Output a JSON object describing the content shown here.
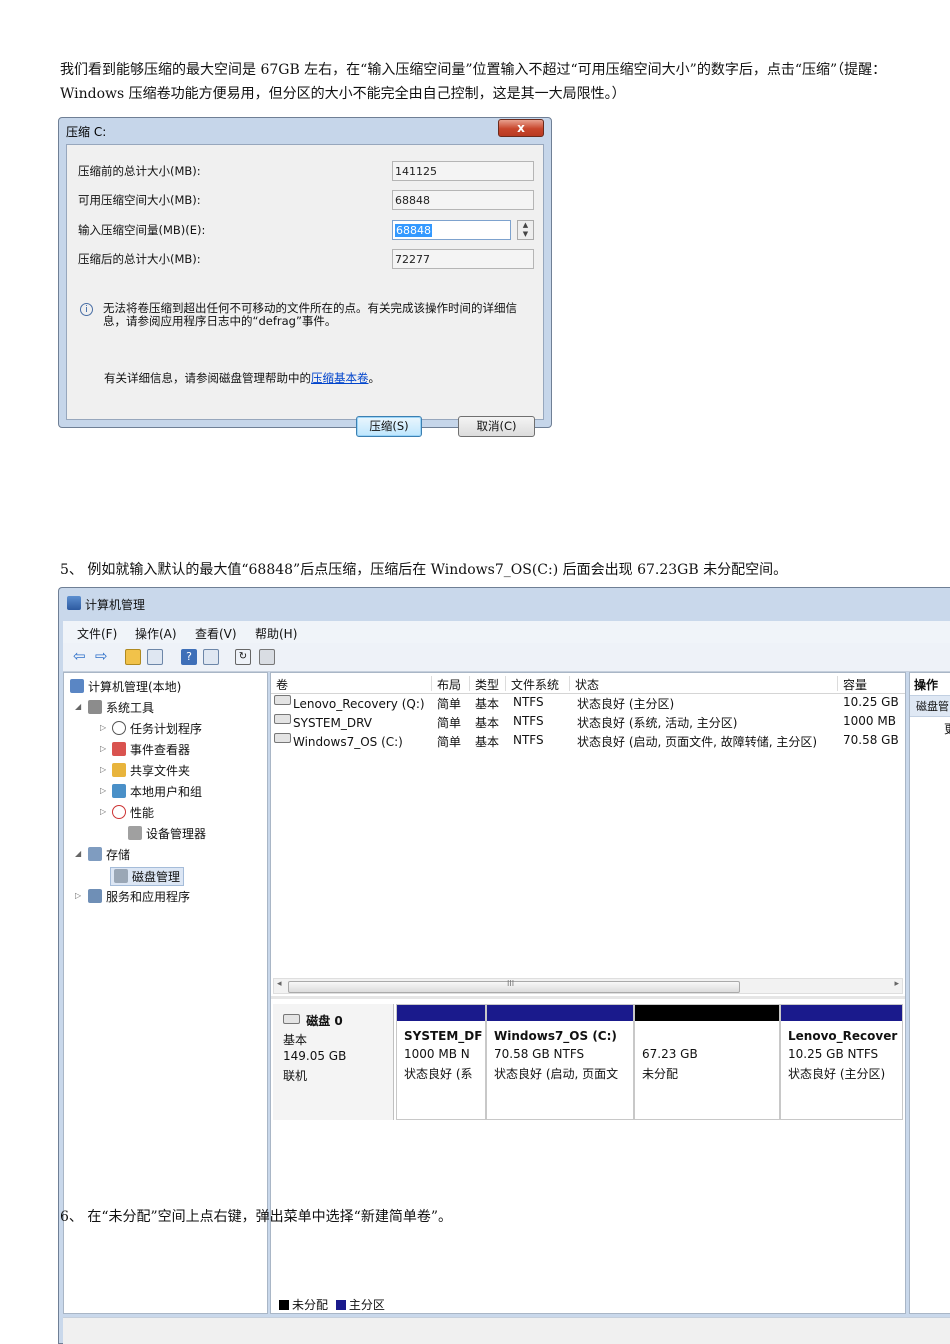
{
  "para1": "我们看到能够压缩的最大空间是 67GB 左右，在“输入压缩空间量”位置输入不超过“可用压缩空间大小”的数字后，点击“压缩”（提醒：Windows 压缩卷功能方便易用，但分区的大小不能完全由自己控制，这是其一大局限性。）",
  "dialog": {
    "title": "压缩 C:",
    "close_label": "x",
    "fields": [
      {
        "label": "压缩前的总计大小(MB):",
        "value": "141125"
      },
      {
        "label": "可用压缩空间大小(MB):",
        "value": "68848"
      },
      {
        "label": "输入压缩空间量(MB)(E):",
        "value": "68848"
      },
      {
        "label": "压缩后的总计大小(MB):",
        "value": "72277"
      }
    ],
    "note": "无法将卷压缩到超出任何不可移动的文件所在的点。有关完成该操作时间的详细信息，请参阅应用程序日志中的“defrag”事件。",
    "more_prefix": "有关详细信息，请参阅磁盘管理帮助中的",
    "more_link": "压缩基本卷",
    "more_suffix": "。",
    "shrink_button": "压缩(S)",
    "cancel_button": "取消(C)"
  },
  "para2": "5、 例如就输入默认的最大值“68848”后点压缩，压缩后在 Windows7_OS(C:) 后面会出现 67.23GB 未分配空间。",
  "para3": "6、 在“未分配”空间上点右键，弹出菜单中选择“新建简单卷”。",
  "cm": {
    "title": "计算机管理",
    "menu": [
      "文件(F)",
      "操作(A)",
      "查看(V)",
      "帮助(H)"
    ],
    "tree": {
      "root": "计算机管理(本地)",
      "system_tools": "系统工具",
      "task_scheduler": "任务计划程序",
      "event_viewer": "事件查看器",
      "shared_folders": "共享文件夹",
      "local_users": "本地用户和组",
      "performance": "性能",
      "device_manager": "设备管理器",
      "storage": "存储",
      "disk_management": "磁盘管理",
      "services": "服务和应用程序"
    },
    "columns": [
      "卷",
      "布局",
      "类型",
      "文件系统",
      "状态",
      "容量"
    ],
    "volumes": [
      {
        "name": "Lenovo_Recovery (Q:)",
        "layout": "简单",
        "type": "基本",
        "fs": "NTFS",
        "status": "状态良好 (主分区)",
        "capacity": "10.25 GB"
      },
      {
        "name": "SYSTEM_DRV",
        "layout": "简单",
        "type": "基本",
        "fs": "NTFS",
        "status": "状态良好 (系统, 活动, 主分区)",
        "capacity": "1000 MB"
      },
      {
        "name": "Windows7_OS (C:)",
        "layout": "简单",
        "type": "基本",
        "fs": "NTFS",
        "status": "状态良好 (启动, 页面文件, 故障转储, 主分区)",
        "capacity": "70.58 GB"
      }
    ],
    "scroll_mark": "III",
    "disk": {
      "name": "磁盘 0",
      "kind": "基本",
      "size": "149.05 GB",
      "state": "联机"
    },
    "partitions": [
      {
        "name": "SYSTEM_DF",
        "size": "1000 MB N",
        "status": "状态良好 (系"
      },
      {
        "name": "Windows7_OS (C:)",
        "size": "70.58 GB NTFS",
        "status": "状态良好 (启动, 页面文"
      },
      {
        "name": "",
        "size": "67.23 GB",
        "status": "未分配"
      },
      {
        "name": "Lenovo_Recover",
        "size": "10.25 GB NTFS",
        "status": "状态良好 (主分区)"
      }
    ],
    "legend_unallocated": "未分配",
    "legend_primary": "主分区",
    "actions_title": "操作",
    "actions_item": "磁盘管",
    "actions_more": "更"
  },
  "colors": {
    "primary_partition": "#1a1a8c",
    "unallocated": "#000000"
  }
}
